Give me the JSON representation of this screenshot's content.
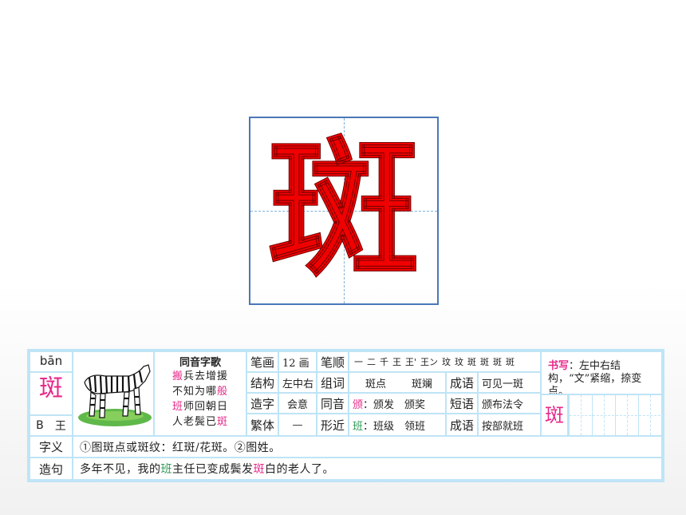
{
  "big_character": "斑",
  "card": {
    "pinyin": "bān",
    "character": "斑",
    "radical_letter": "B",
    "radical": "王",
    "zebra_icon": "zebra-image",
    "homophone_song": {
      "title": "同音字歌",
      "lines": [
        {
          "hl": "搬",
          "rest": "兵去增援"
        },
        {
          "pre": "不知为哪",
          "hl": "般"
        },
        {
          "hl": "班",
          "rest": "师回朝日"
        },
        {
          "pre": "人老鬓已",
          "hl": "斑"
        }
      ]
    },
    "strokes_count": {
      "label": "笔画",
      "value": "12 画"
    },
    "stroke_order": {
      "label": "笔顺",
      "glyphs": [
        "一",
        "二",
        "千",
        "王",
        "王'",
        "王ン",
        "玟",
        "玟",
        "斑",
        "斑",
        "斑",
        "斑"
      ]
    },
    "structure": {
      "label": "结构",
      "value": "左中右"
    },
    "words": {
      "label": "组词",
      "values": [
        "斑点",
        "斑斓"
      ]
    },
    "idiom1": {
      "label": "成语",
      "value": "可见一斑"
    },
    "formation": {
      "label": "造字",
      "value": "会意"
    },
    "homophone": {
      "label": "同音",
      "hl": "颁",
      "rest": "：颁发　颁奖"
    },
    "idiom2": {
      "label": "短语",
      "value": "颁布法令"
    },
    "traditional": {
      "label": "繁体",
      "value": "—"
    },
    "similar": {
      "label": "形近",
      "hl": "班",
      "rest": "：班级　领班"
    },
    "idiom3": {
      "label": "成语",
      "value": "按部就班"
    },
    "writing_tip": {
      "head": "书写",
      "text": "：左中右结构，“文”紧缩，捺变点。"
    },
    "practice_char": "斑",
    "meaning": {
      "label": "字义",
      "value": "①图斑点或斑纹：红斑/花斑。②图姓。"
    },
    "sentence": {
      "label": "造句",
      "pre": "多年不见，我的",
      "hl1": "班",
      "mid": "主任已变成鬓发",
      "hl2": "斑",
      "post": "白的老人了。"
    }
  }
}
